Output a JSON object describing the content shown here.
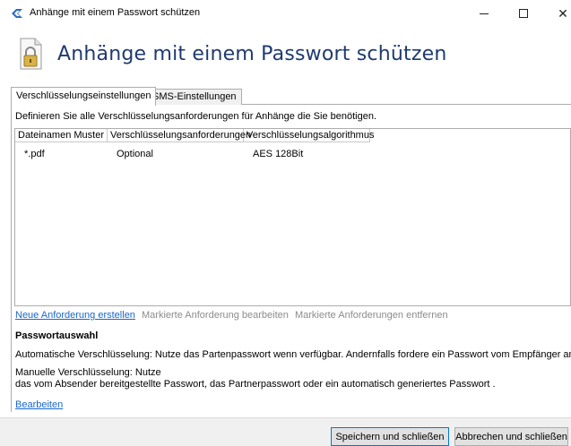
{
  "window": {
    "title": "Anhänge mit einem Passwort schützen",
    "minimize_icon": "minimize-icon",
    "maximize_icon": "maximize-icon",
    "close_icon": "close-icon",
    "close_glyph": "✕"
  },
  "header": {
    "title": "Anhänge mit einem Passwort schützen",
    "icon": "locked-document-icon"
  },
  "tabs": [
    {
      "label": "Verschlüsselungseinstellungen",
      "active": true
    },
    {
      "label": "SMS-Einstellungen",
      "active": false
    }
  ],
  "main": {
    "intro": "Definieren Sie alle Verschlüsselungsanforderungen für Anhänge die Sie benötigen.",
    "table": {
      "columns": [
        "Dateinamen Muster",
        "Verschlüsselungsanforderungen",
        "Verschlüsselungsalgorithmus"
      ],
      "rows": [
        [
          "*.pdf",
          "Optional",
          "AES 128Bit"
        ]
      ]
    },
    "actions": {
      "create": "Neue Anforderung erstellen",
      "edit": "Markierte Anforderung bearbeiten",
      "remove": "Markierte Anforderungen entfernen"
    },
    "password_selection": {
      "title": "Passwortauswahl",
      "auto": "Automatische Verschlüsselung: Nutze das Partenpasswort wenn verfügbar. Andernfalls fordere ein Passwort vom Empfänger an.",
      "manual_line1": "Manuelle Verschlüsselung: Nutze",
      "manual_line2": "das vom Absender bereitgestellte Passwort, das Partnerpasswort oder ein automatisch generiertes Passwort .",
      "edit_link": "Bearbeiten"
    }
  },
  "footer": {
    "save": "Speichern und schließen",
    "cancel": "Abbrechen und schließen"
  },
  "colors": {
    "title_blue": "#1f3a70",
    "link_blue": "#1a66c9",
    "accent": "#0078d7"
  }
}
